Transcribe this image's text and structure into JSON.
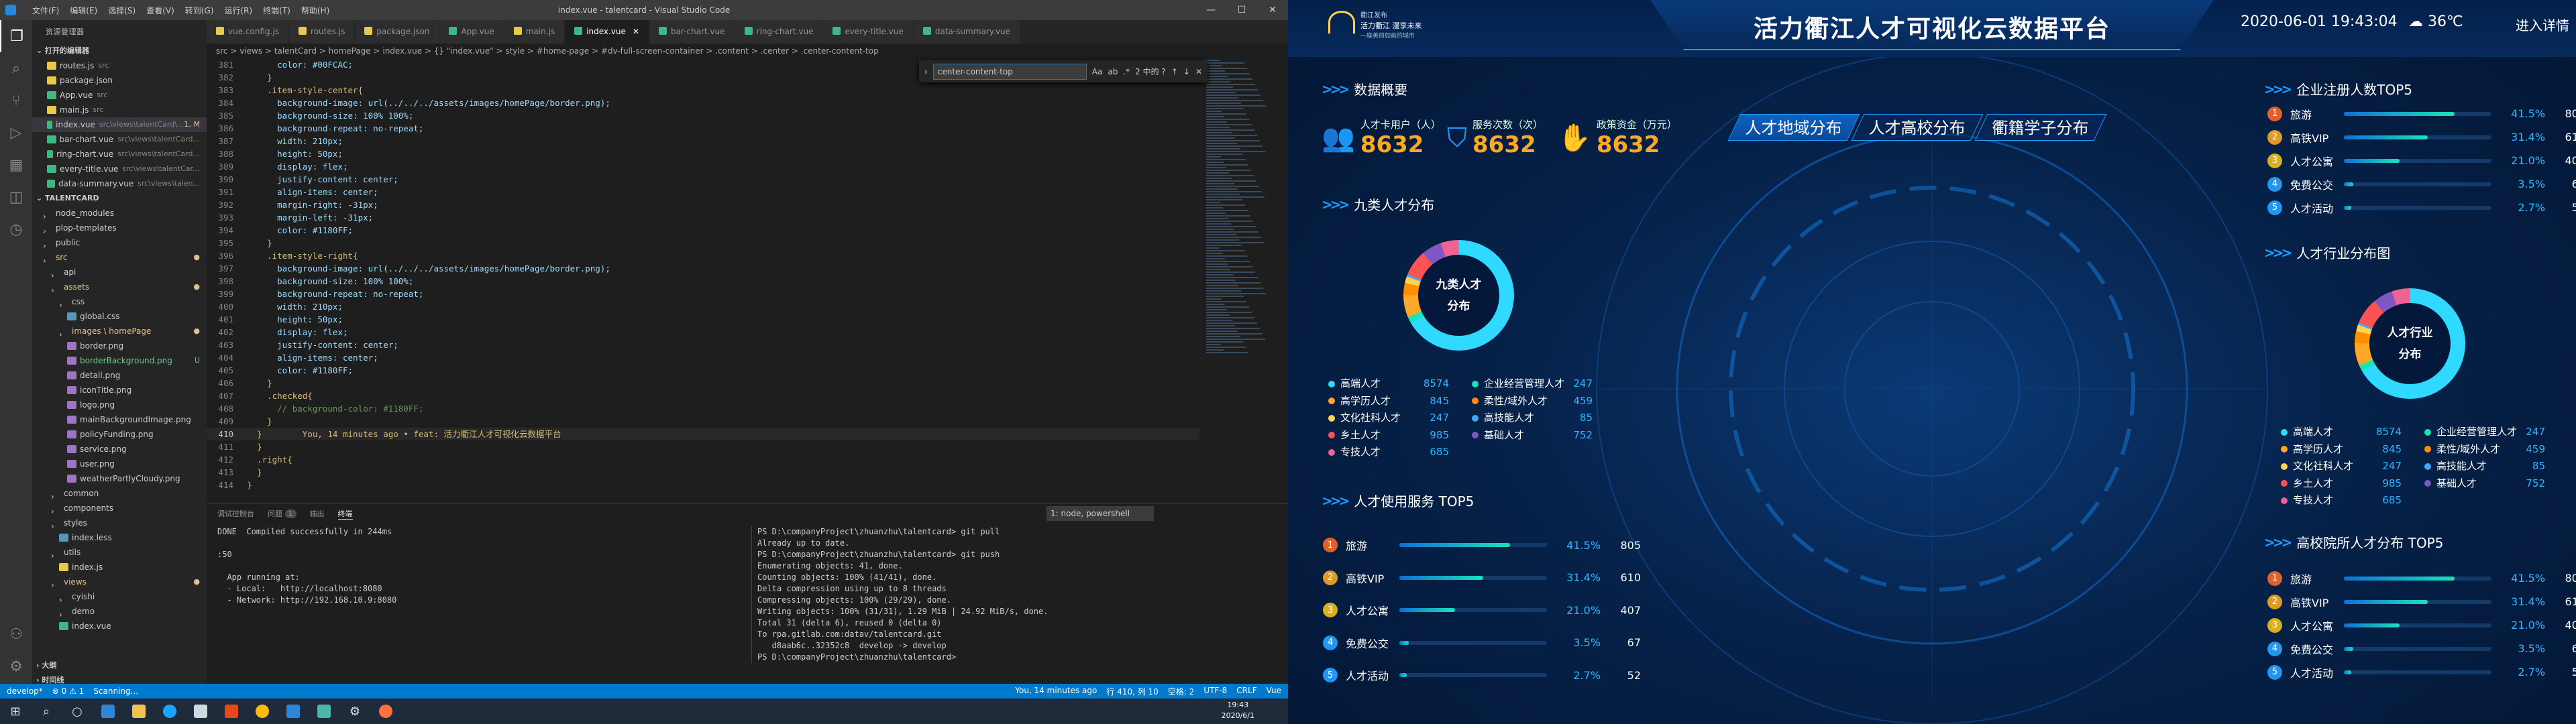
{
  "vscode": {
    "window_title": "index.vue - talentcard - Visual Studio Code",
    "menu": [
      "文件(F)",
      "编辑(E)",
      "选择(S)",
      "查看(V)",
      "转到(G)",
      "运行(R)",
      "终端(T)",
      "帮助(H)"
    ],
    "explorer_title": "资源管理器",
    "open_editors_title": "打开的编辑器",
    "open_editors": [
      {
        "name": "routes.js",
        "desc": "src",
        "badge": ""
      },
      {
        "name": "package.json",
        "desc": "",
        "badge": ""
      },
      {
        "name": "App.vue",
        "desc": "src",
        "badge": ""
      },
      {
        "name": "main.js",
        "desc": "src",
        "badge": ""
      },
      {
        "name": "index.vue",
        "desc": "src\\views\\talentCard\\...",
        "badge": "1, M"
      },
      {
        "name": "bar-chart.vue",
        "desc": "src\\views\\talentCard...",
        "badge": ""
      },
      {
        "name": "ring-chart.vue",
        "desc": "src\\views\\talentCard...",
        "badge": ""
      },
      {
        "name": "every-title.vue",
        "desc": "src\\views\\talentCar...",
        "badge": ""
      },
      {
        "name": "data-summary.vue",
        "desc": "src\\views\\talen...",
        "badge": ""
      }
    ],
    "project_title": "TALENTCARD",
    "tree": [
      {
        "name": "node_modules",
        "badge": ""
      },
      {
        "name": "plop-templates",
        "badge": ""
      },
      {
        "name": "public",
        "badge": ""
      },
      {
        "name": "src",
        "badge": "●"
      },
      {
        "name": "api",
        "badge": ""
      },
      {
        "name": "assets",
        "badge": "●"
      },
      {
        "name": "css",
        "badge": ""
      },
      {
        "name": "global.css",
        "badge": ""
      },
      {
        "name": "images \\ homePage",
        "badge": "●"
      },
      {
        "name": "border.png",
        "badge": ""
      },
      {
        "name": "borderBackground.png",
        "badge": "U"
      },
      {
        "name": "detail.png",
        "badge": ""
      },
      {
        "name": "iconTitle.png",
        "badge": ""
      },
      {
        "name": "logo.png",
        "badge": ""
      },
      {
        "name": "mainBackgroundImage.png",
        "badge": ""
      },
      {
        "name": "policyFunding.png",
        "badge": ""
      },
      {
        "name": "service.png",
        "badge": ""
      },
      {
        "name": "user.png",
        "badge": ""
      },
      {
        "name": "weatherPartlyCloudy.png",
        "badge": ""
      },
      {
        "name": "common",
        "badge": ""
      },
      {
        "name": "components",
        "badge": ""
      },
      {
        "name": "styles",
        "badge": ""
      },
      {
        "name": "index.less",
        "badge": ""
      },
      {
        "name": "utils",
        "badge": ""
      },
      {
        "name": "index.js",
        "badge": ""
      },
      {
        "name": "views",
        "badge": "●"
      },
      {
        "name": "cyishi",
        "badge": ""
      },
      {
        "name": "demo",
        "badge": ""
      },
      {
        "name": "index.vue",
        "badge": ""
      }
    ],
    "outline_title": "大纲",
    "timeline_title": "时间线",
    "npm_title": "NPM 脚本",
    "tabs": [
      "vue.config.js",
      "routes.js",
      "package.json",
      "App.vue",
      "main.js",
      "index.vue",
      "bar-chart.vue",
      "ring-chart.vue",
      "every-title.vue",
      "data-summary.vue"
    ],
    "active_tab": "index.vue",
    "breadcrumb": "src > views > talentCard > homePage > index.vue > {} \"index.vue\" > style > #home-page > #dv-full-screen-container > .content > .center > .center-content-top",
    "find_value": "center-content-top",
    "find_result": "2 中的 ?",
    "code": [
      {
        "ln": "381",
        "t": "      color: #00FCAC;"
      },
      {
        "ln": "382",
        "t": "    }"
      },
      {
        "ln": "383",
        "t": "    .item-style-center{"
      },
      {
        "ln": "384",
        "t": "      background-image: url(../../../assets/images/homePage/border.png);"
      },
      {
        "ln": "385",
        "t": "      background-size: 100% 100%;"
      },
      {
        "ln": "386",
        "t": "      background-repeat: no-repeat;"
      },
      {
        "ln": "387",
        "t": "      width: 210px;"
      },
      {
        "ln": "388",
        "t": "      height: 50px;"
      },
      {
        "ln": "389",
        "t": "      display: flex;"
      },
      {
        "ln": "390",
        "t": "      justify-content: center;"
      },
      {
        "ln": "391",
        "t": "      align-items: center;"
      },
      {
        "ln": "392",
        "t": "      margin-right: -31px;"
      },
      {
        "ln": "393",
        "t": "      margin-left: -31px;"
      },
      {
        "ln": "394",
        "t": "      color: #1180FF;"
      },
      {
        "ln": "395",
        "t": "    }"
      },
      {
        "ln": "396",
        "t": "    .item-style-right{"
      },
      {
        "ln": "397",
        "t": "      background-image: url(../../../assets/images/homePage/border.png);"
      },
      {
        "ln": "398",
        "t": "      background-size: 100% 100%;"
      },
      {
        "ln": "399",
        "t": "      background-repeat: no-repeat;"
      },
      {
        "ln": "400",
        "t": "      width: 210px;"
      },
      {
        "ln": "401",
        "t": "      height: 50px;"
      },
      {
        "ln": "402",
        "t": "      display: flex;"
      },
      {
        "ln": "403",
        "t": "      justify-content: center;"
      },
      {
        "ln": "404",
        "t": "      align-items: center;"
      },
      {
        "ln": "405",
        "t": "      color: #1180FF;"
      },
      {
        "ln": "406",
        "t": "    }"
      },
      {
        "ln": "407",
        "t": "    .checked{"
      },
      {
        "ln": "408",
        "t": "      // background-color: #1180FF;"
      },
      {
        "ln": "409",
        "t": "    }"
      },
      {
        "ln": "410",
        "t": "  }        You, 14 minutes ago • feat: 活力衢江人才可视化云数据平台"
      },
      {
        "ln": "411",
        "t": "  }"
      },
      {
        "ln": "412",
        "t": "  .right{"
      },
      {
        "ln": "413",
        "t": "  }"
      },
      {
        "ln": "414",
        "t": "}"
      }
    ],
    "panel_tabs": [
      "调试控制台",
      "问题",
      "输出",
      "终端"
    ],
    "problems_count": "1",
    "terminal_select": "1: node, powershell",
    "term_left": "DONE  Compiled successfully in 244ms\n\n:50\n\n  App running at:\n  - Local:   http://localhost:8080\n  - Network: http://192.168.10.9:8080\n",
    "term_right": "PS D:\\companyProject\\zhuanzhu\\talentcard> git pull\nAlready up to date.\nPS D:\\companyProject\\zhuanzhu\\talentcard> git push\nEnumerating objects: 41, done.\nCounting objects: 100% (41/41), done.\nDelta compression using up to 8 threads\nCompressing objects: 100% (29/29), done.\nWriting objects: 100% (31/31), 1.29 MiB | 24.92 MiB/s, done.\nTotal 31 (delta 6), reused 0 (delta 0)\nTo rpa.gitlab.com:datav/talentcard.git\n   d8aab6c..32352c8  develop -> develop\nPS D:\\companyProject\\zhuanzhu\\talentcard> ",
    "status_left": [
      "develop*",
      "⊗ 0 ⚠ 1",
      "Scanning..."
    ],
    "status_right": [
      "You, 14 minutes ago",
      "行 410, 列 10",
      "空格: 2",
      "UTF-8",
      "CRLF",
      "Vue"
    ],
    "clock_time": "19:43",
    "clock_date": "2020/6/1"
  },
  "dash": {
    "title": "活力衢江人才可视化云数据平台",
    "logo_lines": [
      "衢江发布",
      "活力衢江 漫享未来",
      "一座美丽如画的城市"
    ],
    "datetime": "2020-06-01 19:43:04",
    "weather": "36℃",
    "enter": "进入详情",
    "sec_overview": "数据概要",
    "kpis": [
      {
        "label": "人才卡用户（人）",
        "value": "8632"
      },
      {
        "label": "服务次数（次）",
        "value": "8632"
      },
      {
        "label": "政策资金（万元）",
        "value": "8632"
      }
    ],
    "sec_nine": "九类人才分布",
    "nine_center": [
      "九类人才",
      "分布"
    ],
    "tabs": [
      "人才地域分布",
      "人才高校分布",
      "衢籍学子分布"
    ],
    "sec_service": "人才使用服务 TOP5",
    "sec_enterprise": "企业注册人数TOP5",
    "sec_industry": "人才行业分布图",
    "industry_center": [
      "人才行业",
      "分布"
    ],
    "sec_college": "高校院所人才分布 TOP5",
    "top5": [
      {
        "rank": "1",
        "name": "旅游",
        "pct": "41.5%",
        "count": "805",
        "p": 41.5
      },
      {
        "rank": "2",
        "name": "高铁VIP",
        "pct": "31.4%",
        "count": "610",
        "p": 31.4
      },
      {
        "rank": "3",
        "name": "人才公寓",
        "pct": "21.0%",
        "count": "407",
        "p": 21.0
      },
      {
        "rank": "4",
        "name": "免费公交",
        "pct": "3.5%",
        "count": "67",
        "p": 3.5
      },
      {
        "rank": "5",
        "name": "人才活动",
        "pct": "2.7%",
        "count": "52",
        "p": 2.7
      }
    ],
    "talent_legend": [
      {
        "name": "高端人才",
        "value": "8574",
        "color": "#2fd9ff"
      },
      {
        "name": "企业经营管理人才",
        "value": "247",
        "color": "#19e3b8"
      },
      {
        "name": "高学历人才",
        "value": "845",
        "color": "#ffa726"
      },
      {
        "name": "柔性/域外人才",
        "value": "459",
        "color": "#ff8f00"
      },
      {
        "name": "文化社科人才",
        "value": "247",
        "color": "#ffd54f"
      },
      {
        "name": "高技能人才",
        "value": "85",
        "color": "#3fa9ff"
      },
      {
        "name": "乡土人才",
        "value": "985",
        "color": "#ff5252"
      },
      {
        "name": "基础人才",
        "value": "752",
        "color": "#7e57c2"
      },
      {
        "name": "专技人才",
        "value": "685",
        "color": "#f06292"
      }
    ],
    "rank_colors": [
      "#e0622a",
      "#e09a2a",
      "#d8b020",
      "#2196f3",
      "#2196f3"
    ]
  }
}
